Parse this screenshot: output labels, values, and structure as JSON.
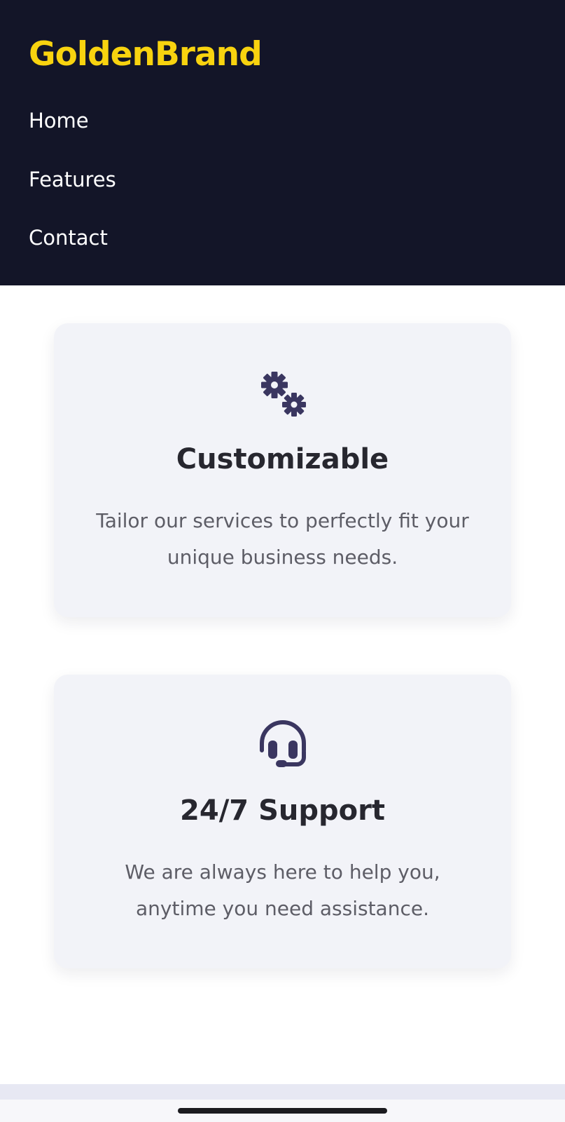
{
  "header": {
    "brand": "GoldenBrand",
    "nav": [
      {
        "label": "Home"
      },
      {
        "label": "Features"
      },
      {
        "label": "Contact"
      }
    ]
  },
  "features": [
    {
      "icon": "gears-icon",
      "title": "Customizable",
      "description": "Tailor our services to perfectly fit your unique business needs."
    },
    {
      "icon": "headset-icon",
      "title": "24/7 Support",
      "description": "We are always here to help you, anytime you need assistance."
    }
  ],
  "colors": {
    "header_bg": "#131528",
    "brand": "#f8d30f",
    "card_bg": "#f2f3f8",
    "icon": "#3a3660",
    "title": "#27272f",
    "text": "#5d5d66"
  }
}
